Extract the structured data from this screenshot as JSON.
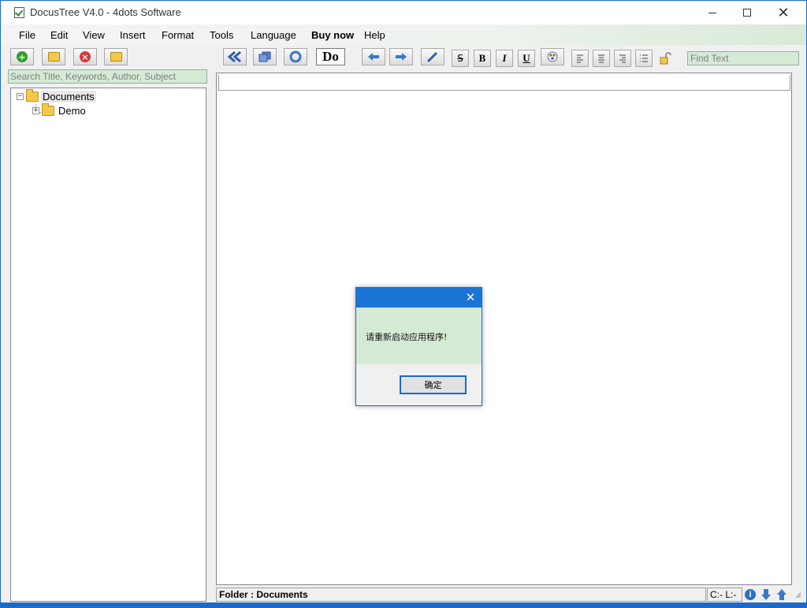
{
  "window": {
    "title": "DocusTree V4.0 - 4dots Software"
  },
  "titlebar": {
    "minimize": "—",
    "maximize": "☐",
    "close": "✕"
  },
  "menu": [
    "File",
    "Edit",
    "View",
    "Insert",
    "Format",
    "Tools",
    "Language",
    "Buy now",
    "Help"
  ],
  "toolbar": {
    "do_label": "Do",
    "bold": "B",
    "italic": "I",
    "underline": "U",
    "strike": "S",
    "find_placeholder": "Find Text"
  },
  "search": {
    "placeholder": "Search Title,  Keywords, Author, Subject"
  },
  "tree": {
    "root": {
      "label": "Documents",
      "expander": "−"
    },
    "child": {
      "label": "Demo",
      "expander": "+"
    }
  },
  "status": {
    "folder": "Folder : Documents",
    "position": "C:-  L:-"
  },
  "dialog": {
    "close": "✕",
    "message": "请重新启动应用程序!",
    "ok": "确定"
  },
  "colors": {
    "accent": "#1a74d4",
    "pale_green": "#d5ead5",
    "folder": "#f2c94c"
  }
}
